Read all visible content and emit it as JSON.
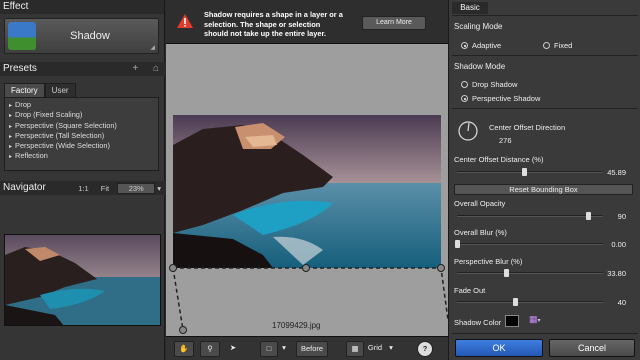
{
  "left": {
    "effect_header": "Effect",
    "effect_name": "Shadow",
    "presets_header": "Presets",
    "presets_icons": {
      "add": "+",
      "home": "home-icon"
    },
    "tabs": [
      "Factory",
      "User"
    ],
    "preset_items": [
      "Drop",
      "Drop (Fixed Scaling)",
      "Perspective (Square Selection)",
      "Perspective (Tall Selection)",
      "Perspective (Wide Selection)",
      "Reflection"
    ],
    "navigator_header": "Navigator",
    "nav_one_to_one": "1:1",
    "nav_fit": "Fit",
    "nav_zoom": "23%"
  },
  "center": {
    "warning_text": "Shadow requires a shape in a layer or a selection. The shape or selection should not take up the entire layer.",
    "learn_more": "Learn More",
    "filename": "17099429.jpg",
    "toolbar": {
      "before": "Before",
      "grid": "Grid",
      "help": "?"
    }
  },
  "right": {
    "tab": "Basic",
    "scaling_mode_title": "Scaling Mode",
    "scaling_adaptive": "Adaptive",
    "scaling_fixed": "Fixed",
    "shadow_mode_title": "Shadow Mode",
    "mode_drop": "Drop Shadow",
    "mode_perspective": "Perspective Shadow",
    "center_offset_direction": "Center Offset Direction",
    "center_offset_direction_value": "276",
    "center_offset_distance": "Center Offset Distance (%)",
    "center_offset_distance_value": "45.89",
    "reset_bounding_box": "Reset Bounding Box",
    "overall_opacity": "Overall Opacity",
    "overall_opacity_value": "90",
    "overall_blur": "Overall Blur (%)",
    "overall_blur_value": "0.00",
    "perspective_blur": "Perspective Blur (%)",
    "perspective_blur_value": "33.80",
    "fade_out": "Fade Out",
    "fade_out_value": "40",
    "shadow_color": "Shadow Color",
    "shadow_color_hex": "#000000",
    "ok": "OK",
    "cancel": "Cancel"
  },
  "sliders": {
    "center_offset_distance": 0.46,
    "overall_opacity": 0.9,
    "overall_blur": 0.0,
    "perspective_blur": 0.338,
    "fade_out": 0.4
  },
  "colors": {
    "accent": "#2f6fd6",
    "warning": "#e53b2c",
    "panel": "#3a3a3a"
  }
}
